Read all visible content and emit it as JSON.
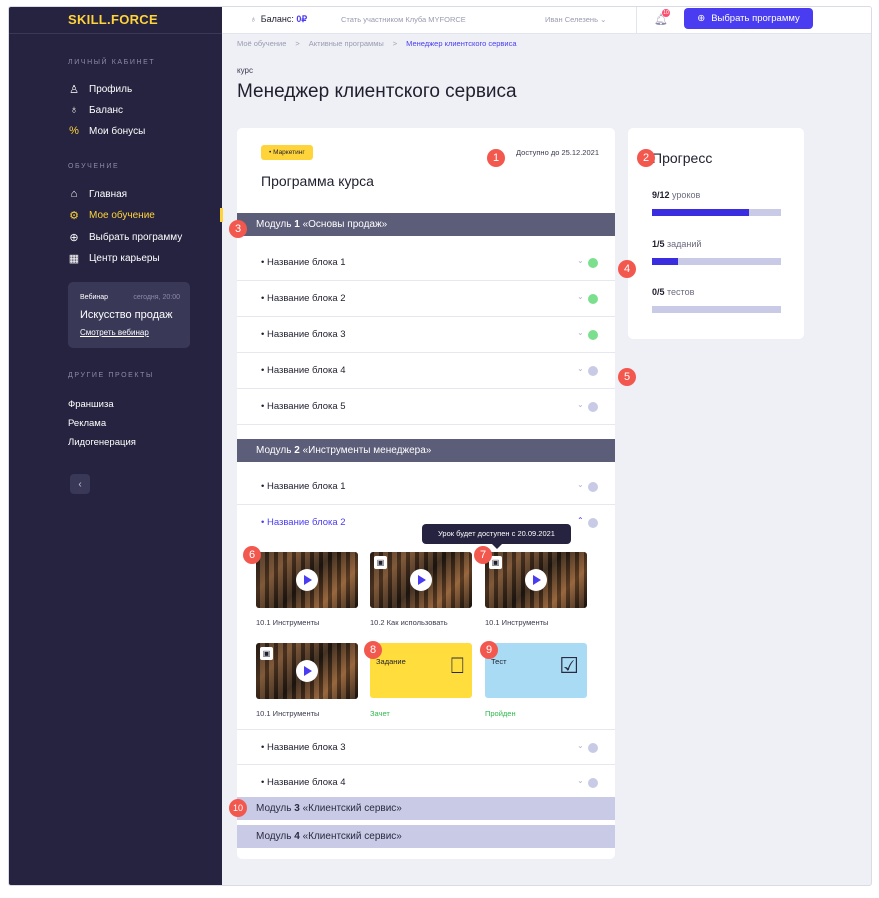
{
  "app": {
    "logo": "SKILL.FORCE"
  },
  "sidebar": {
    "section_personal": "ЛИЧНЫЙ КАБИНЕТ",
    "personal": [
      {
        "icon": "user-icon",
        "glyph": "♙",
        "label": "Профиль"
      },
      {
        "icon": "wallet-icon",
        "glyph": "♁",
        "label": "Баланс"
      },
      {
        "icon": "percent-icon",
        "glyph": "%",
        "label": "Мои бонусы"
      }
    ],
    "section_study": "ОБУЧЕНИЕ",
    "study": [
      {
        "icon": "home-icon",
        "glyph": "⌂",
        "label": "Главная"
      },
      {
        "icon": "gear-icon",
        "glyph": "⚙",
        "label": "Мое обучение",
        "active": true
      },
      {
        "icon": "plus-circle-icon",
        "glyph": "⊕",
        "label": "Выбрать программу"
      },
      {
        "icon": "career-icon",
        "glyph": "▦",
        "label": "Центр карьеры"
      }
    ],
    "webinar": {
      "label": "Вебинар",
      "time": "сегодня, 20:00",
      "title": "Искусство продаж",
      "link": "Смотреть вебинар"
    },
    "section_projects": "ДРУГИЕ ПРОЕКТЫ",
    "projects": [
      "Франшиза",
      "Реклама",
      "Лидогенерация"
    ],
    "collapse_glyph": "‹"
  },
  "header": {
    "balance_label": "Баланс:",
    "balance_value": "0₽",
    "club_link": "Стать участником Клуба MYFORCE",
    "user_name": "Иван Селезень",
    "notifications": "10",
    "cta": "Выбрать программу"
  },
  "breadcrumbs": [
    "Моё обучение",
    "Активные программы",
    "Менеджер клиентского сервиса"
  ],
  "page": {
    "kicker": "курс",
    "title": "Менеджер клиентского сервиса"
  },
  "program": {
    "tag": "• Маркетинг",
    "available": "Доступно до 25.12.2021",
    "title": "Программа курса",
    "modules": [
      {
        "prefix": "Модуль ",
        "num": "1",
        "name": " «Основы продаж»"
      },
      {
        "prefix": "Модуль ",
        "num": "2",
        "name": " «Инструменты менеджера»"
      },
      {
        "prefix": "Модуль ",
        "num": "3",
        "name": " «Клиентский сервис»"
      },
      {
        "prefix": "Модуль ",
        "num": "4",
        "name": " «Клиентский сервис»"
      }
    ],
    "module1_blocks": [
      "• Название блока 1",
      "• Название блока 2",
      "• Название блока 3",
      "• Название блока 4",
      "• Название блока 5"
    ],
    "module2_blocks": [
      "• Название блока 1",
      "• Название блока 2",
      "• Название блока 3",
      "• Название блока 4"
    ],
    "lessons": [
      "10.1 Инструменты",
      "10.2 Как использовать",
      "10.1 Инструменты",
      "10.1 Инструменты"
    ],
    "task": {
      "name": "Задание",
      "status": "Зачет"
    },
    "test": {
      "name": "Тест",
      "status": "Пройден"
    },
    "tooltip": "Урок будет доступен с 20.09.2021"
  },
  "progress": {
    "title": "Прогресс",
    "lessons": {
      "count": "9/12",
      "label": " уроков",
      "fraction": 0.75
    },
    "tasks": {
      "count": "1/5",
      "label": " заданий",
      "fraction": 0.2
    },
    "tests": {
      "count": "0/5",
      "label": " тестов",
      "fraction": 0
    }
  },
  "badges": [
    "1",
    "2",
    "3",
    "4",
    "5",
    "6",
    "7",
    "8",
    "9",
    "10"
  ],
  "colors": {
    "accent": "#4a3cf0",
    "brand_yellow": "#ffd43b",
    "sidebar": "#25233f",
    "success": "#7cdf8e",
    "badge": "#f2584e"
  }
}
